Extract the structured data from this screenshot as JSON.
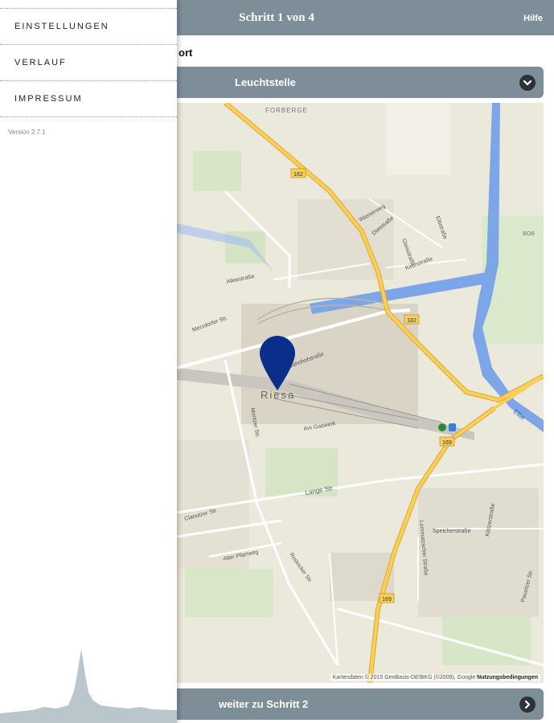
{
  "header": {
    "title": "Schritt 1 von 4",
    "help_label": "Hilfe"
  },
  "main": {
    "section_label": "ort",
    "select": {
      "selected": "Leuchtstelle",
      "icon": "chevron-down-icon"
    },
    "next_button": {
      "label": "weiter zu Schritt 2",
      "icon": "chevron-right-icon"
    }
  },
  "map": {
    "city_label": "Riesa",
    "road_labels": [
      "FORBERGE",
      "Wasserweg",
      "Gleisstraße",
      "Elbstraße",
      "Dietstraße",
      "Kirchstraße",
      "Alleestraße",
      "Merzdorfer Str.",
      "Bahnhofstraße",
      "Am Gaswerk",
      "Moritzer Str.",
      "Lange Str.",
      "Clanutzer Str.",
      "Alter Pfarrweg",
      "Rostocker Str.",
      "Speicherstraße",
      "Lommatzscher Straße",
      "Klötzerstraße",
      "Pausitzer Str.",
      "Elbe",
      "BOB"
    ],
    "road_shields": [
      "182",
      "182",
      "169",
      "169"
    ],
    "attribution": "Kartendaten © 2015 GeoBasis-DE/BKG (©2009), Google",
    "terms_label": "Nutzungsbedingungen",
    "pin_color": "#0a2f8a"
  },
  "sidemenu": {
    "items": [
      {
        "label": "EINSTELLUNGEN"
      },
      {
        "label": "VERLAUF"
      },
      {
        "label": "IMPRESSUM"
      }
    ],
    "version": "Version 2.7.1"
  },
  "colors": {
    "bar": "#7d8e99",
    "button_circle": "#2b3338",
    "road_major": "#f3c24a",
    "water": "#7da6e8"
  }
}
